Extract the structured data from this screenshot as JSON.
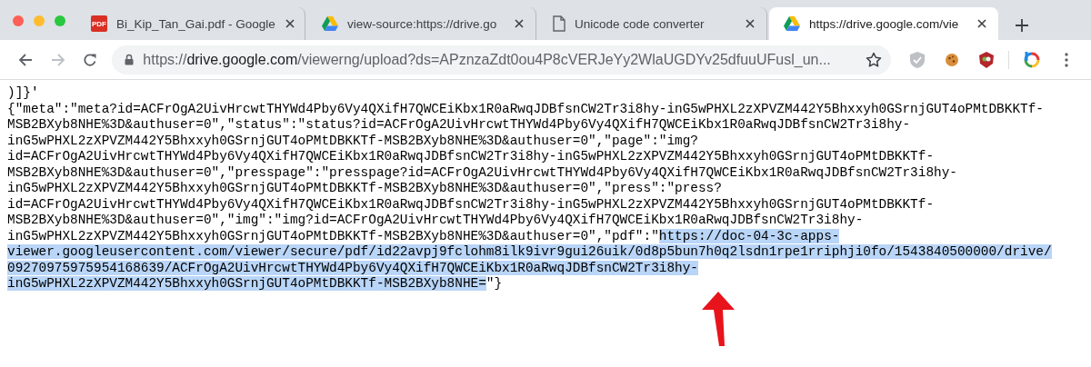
{
  "tabs": [
    {
      "kind": "pdf",
      "icon_text": "PDF",
      "title": "Bi_Kip_Tan_Gai.pdf - Google",
      "selected": false
    },
    {
      "kind": "drive",
      "title": "view-source:https://drive.go",
      "selected": false
    },
    {
      "kind": "page",
      "title": "Unicode code converter",
      "selected": false
    },
    {
      "kind": "drive",
      "title": "https://drive.google.com/vie",
      "selected": true
    }
  ],
  "toolbar": {
    "back_disabled": false,
    "forward_disabled": true,
    "address": {
      "scheme": "https://",
      "host": "drive.google.com",
      "path": "/viewerng/upload?ds=APznzaZdt0ou4P8cVERJeYy2WlaUGDYv25dfuuUFusl_un..."
    }
  },
  "source_lines": [
    [
      {
        "text": ")]}'",
        "selected": false
      }
    ],
    [
      {
        "text": "{\"meta\":\"meta?id=ACFrOgA2UivHrcwtTHYWd4Pby6Vy4QXifH7QWCEiKbx1R0aRwqJDBfsnCW2Tr3i8hy-inG5wPHXL2zXPVZM442Y5Bhxxyh0GSrnjGUT4oPMtDBKKTf-",
        "selected": false
      }
    ],
    [
      {
        "text": "MSB2BXyb8NHE%3D&authuser=0\",\"status\":\"status?id=ACFrOgA2UivHrcwtTHYWd4Pby6Vy4QXifH7QWCEiKbx1R0aRwqJDBfsnCW2Tr3i8hy-",
        "selected": false
      }
    ],
    [
      {
        "text": "inG5wPHXL2zXPVZM442Y5Bhxxyh0GSrnjGUT4oPMtDBKKTf-MSB2BXyb8NHE%3D&authuser=0\",\"page\":\"img?",
        "selected": false
      }
    ],
    [
      {
        "text": "id=ACFrOgA2UivHrcwtTHYWd4Pby6Vy4QXifH7QWCEiKbx1R0aRwqJDBfsnCW2Tr3i8hy-inG5wPHXL2zXPVZM442Y5Bhxxyh0GSrnjGUT4oPMtDBKKTf-",
        "selected": false
      }
    ],
    [
      {
        "text": "MSB2BXyb8NHE%3D&authuser=0\",\"presspage\":\"presspage?id=ACFrOgA2UivHrcwtTHYWd4Pby6Vy4QXifH7QWCEiKbx1R0aRwqJDBfsnCW2Tr3i8hy-",
        "selected": false
      }
    ],
    [
      {
        "text": "inG5wPHXL2zXPVZM442Y5Bhxxyh0GSrnjGUT4oPMtDBKKTf-MSB2BXyb8NHE%3D&authuser=0\",\"press\":\"press?",
        "selected": false
      }
    ],
    [
      {
        "text": "id=ACFrOgA2UivHrcwtTHYWd4Pby6Vy4QXifH7QWCEiKbx1R0aRwqJDBfsnCW2Tr3i8hy-inG5wPHXL2zXPVZM442Y5Bhxxyh0GSrnjGUT4oPMtDBKKTf-",
        "selected": false
      }
    ],
    [
      {
        "text": "MSB2BXyb8NHE%3D&authuser=0\",\"img\":\"img?id=ACFrOgA2UivHrcwtTHYWd4Pby6Vy4QXifH7QWCEiKbx1R0aRwqJDBfsnCW2Tr3i8hy-",
        "selected": false
      }
    ],
    [
      {
        "text": "inG5wPHXL2zXPVZM442Y5Bhxxyh0GSrnjGUT4oPMtDBKKTf-MSB2BXyb8NHE%3D&authuser=0\",\"pdf\":\"",
        "selected": false
      },
      {
        "text": "https://doc-04-3c-apps-",
        "selected": true
      }
    ],
    [
      {
        "text": "viewer.googleusercontent.com/viewer/secure/pdf/id22avpj9fclohm8ilk9ivr9gui26uik/0d8p5bun7h0q2lsdn1rpe1rriphji0fo/1543840500000/drive/",
        "selected": true
      }
    ],
    [
      {
        "text": "09270975975954168639/ACFrOgA2UivHrcwtTHYWd4Pby6Vy4QXifH7QWCEiKbx1R0aRwqJDBfsnCW2Tr3i8hy-",
        "selected": true
      }
    ],
    [
      {
        "text": "inG5wPHXL2zXPVZM442Y5Bhxxyh0GSrnjGUT4oPMtDBKKTf-MSB2BXyb8NHE=",
        "selected": true
      },
      {
        "text": "\"}",
        "selected": false
      }
    ]
  ]
}
